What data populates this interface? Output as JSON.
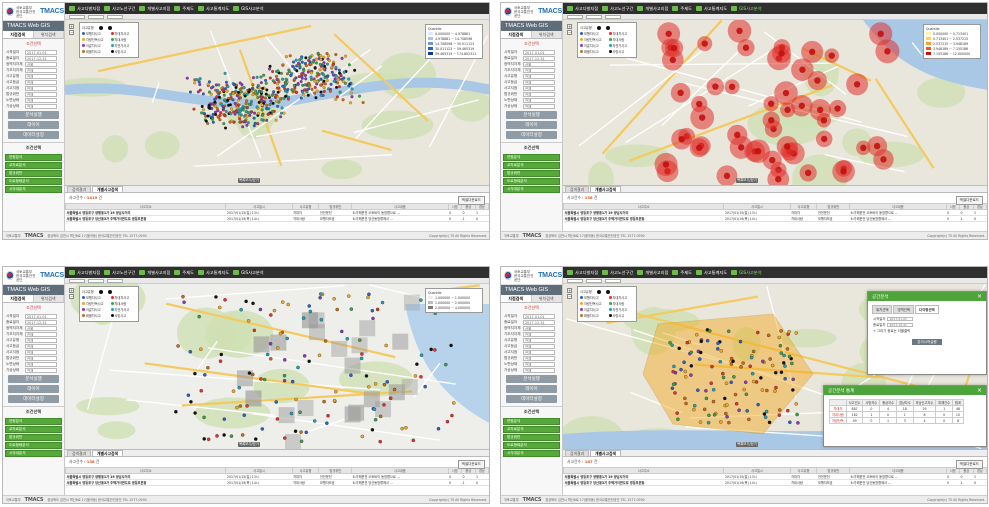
{
  "app": {
    "org_line1": "국토교통부",
    "org_line2": "한국교통안전공단",
    "brand": "TMACS",
    "web_gis_title": "TMACS Web GIS",
    "tab_accident": "지점검색",
    "tab_region": "위치검색",
    "footer_org": "국토교통부",
    "footer_brand": "TMACS",
    "footer_address": "경상북도 김천시 혁신6로 17(율곡동) 한국교통안전공단 TEL 1577-0990",
    "footer_copy": "Copyright(c) TS All Rights Reserved."
  },
  "nav": {
    "items": [
      "사고다발지점",
      "사고노선구간",
      "개별사고지점",
      "주제도",
      "사고통계지도",
      "GIS사고분석"
    ]
  },
  "filters": {
    "section_title": "조건선택",
    "rows": [
      {
        "label": "시작일자",
        "value": "2017-01-01"
      },
      {
        "label": "종료일자",
        "value": "2017-12-31"
      },
      {
        "label": "광역지자체",
        "value": "서울"
      },
      {
        "label": "기초지자체",
        "value": "전체"
      },
      {
        "label": "사고유형",
        "value": "전체"
      },
      {
        "label": "사고등급",
        "value": "전체"
      },
      {
        "label": "사고지점",
        "value": "전체"
      },
      {
        "label": "법규위반",
        "value": "전체"
      },
      {
        "label": "노면상태",
        "value": "전체"
      },
      {
        "label": "기상상태",
        "value": "전체"
      }
    ],
    "buttons": [
      "분석실행",
      "레이어",
      "데이터설정"
    ]
  },
  "conditions": {
    "title": "조건선택",
    "items": [
      "연령분석",
      "교차로분석",
      "법규위반",
      "도로형태분석",
      "시각대분석"
    ]
  },
  "screens": [
    {
      "legend_title": "사고유형",
      "quant_title": "Quantile",
      "quantiles": [
        "0.000000 ~ 4.978881",
        "4.978881 ~ 14.708598",
        "14.708598 ~ 30.011123",
        "30.011123 ~ 59.465319",
        "59.465319 ~ 174.802311"
      ]
    },
    {
      "legend_title": "사고유형",
      "quant_title": "Quantile",
      "quantiles": [
        "0.000000 ~ 0.713401",
        "0.713401 ~ 2.537215",
        "2.537215 ~ 3.948189",
        "3.948189 ~ 7.155186",
        "7.155186 ~ 12.000000"
      ]
    },
    {
      "legend_title": "사고유형",
      "quant_title": "Quantile",
      "quantiles": [
        "1.000000 ~ 1.000000",
        "1.000000 ~ 2.000000",
        "2.000000 ~ 4.000000"
      ]
    },
    {
      "legend_title": "사고유형",
      "quant_title": "",
      "quantiles": []
    }
  ],
  "legend_items": [
    {
      "label": "보행자사고",
      "color": "#2a62c9"
    },
    {
      "label": "차대차사고",
      "color": "#e0312b"
    },
    {
      "label": "차량단독사고",
      "color": "#f2a81a"
    },
    {
      "label": "차대사람",
      "color": "#3aa14b"
    },
    {
      "label": "이륜차사고",
      "color": "#8a3bb5"
    },
    {
      "label": "자전거사고",
      "color": "#1fa2b8"
    },
    {
      "label": "화물차사고",
      "color": "#c96b14"
    },
    {
      "label": "사망사고",
      "color": "#111111"
    }
  ],
  "result": {
    "tab_list": "검색결과",
    "tab_detail": "개별사고검색",
    "tab_stats": "통계",
    "count_label": "사고건수 :",
    "counts": [
      "1419",
      "138",
      "138",
      "187"
    ],
    "count_unit": "건",
    "excel": "엑셀다운로드",
    "toggle": "목록보기/닫기",
    "columns": [
      "사고주소",
      "사고일시",
      "사고유형",
      "법규위반",
      "사고내용",
      "사망",
      "중상",
      "경상"
    ],
    "rows": [
      [
        "서울특별시 영등포구 양평동1가 19 양남사거리",
        "2017/01/15(일) 13시",
        "차대차",
        "안전운전",
        "6:가해운전 오토바이 동방향으로 ...",
        "0",
        "0",
        "1"
      ],
      [
        "서울특별시 영등포구 당산동3가 주택가이면도로 영등포본동",
        "2017/01/19(목) 14시",
        "차대사람",
        "보행자보호",
        "6:가해운전 당산동방향에서 ...",
        "0",
        "1",
        "0"
      ]
    ]
  },
  "spatial": {
    "title": "공간분석",
    "tabs": [
      "위치선택",
      "영역선택",
      "다각형선택"
    ],
    "start_label": "시작일자",
    "start_value": "2017-01-01",
    "end_label": "종료일자",
    "end_value": "2017-12-31",
    "note": "+ 그리기 종료는 더블클릭",
    "run": "분석시작실행",
    "stats_title": "공간분석 통계",
    "stat_cols": [
      "사고건수",
      "사망자수",
      "중상자수",
      "경상자수",
      "부상신고자수",
      "피해건수",
      "합계"
    ],
    "stat_rows": [
      [
        "차대차",
        "887",
        "0",
        "4",
        "18",
        "29",
        "1",
        "48"
      ],
      [
        "차대사람",
        "162",
        "1",
        "0",
        "1",
        "8",
        "0",
        "10"
      ],
      [
        "차량단독",
        "49",
        "0",
        "1",
        "3",
        "4",
        "0",
        "8"
      ]
    ]
  }
}
